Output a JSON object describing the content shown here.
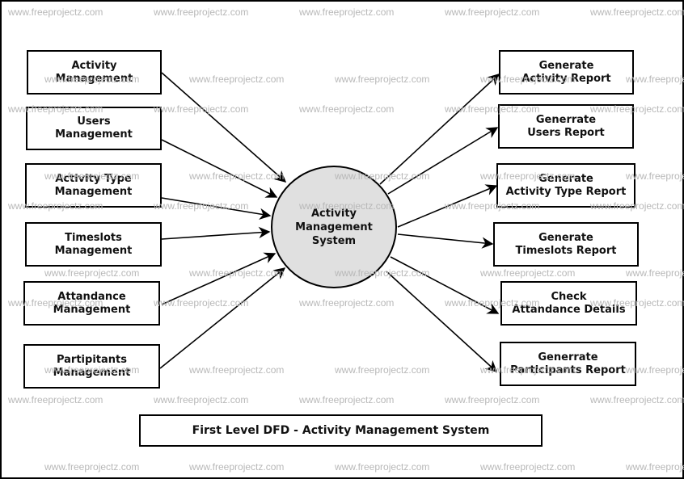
{
  "diagram": {
    "type": "data-flow-diagram",
    "title": "First Level DFD - Activity Management System",
    "process": {
      "id": "p0",
      "label": "Activity\nManagement\nSystem"
    },
    "inputs": [
      {
        "id": "in1",
        "label": "Activity\nManagement"
      },
      {
        "id": "in2",
        "label": "Users\nManagement"
      },
      {
        "id": "in3",
        "label": "Activity Type\nManagement"
      },
      {
        "id": "in4",
        "label": "Timeslots\nManagement"
      },
      {
        "id": "in5",
        "label": "Attandance\nManagement"
      },
      {
        "id": "in6",
        "label": "Partipitants\nManagement"
      }
    ],
    "outputs": [
      {
        "id": "out1",
        "label": "Generate\nActivity Report"
      },
      {
        "id": "out2",
        "label": "Generrate\nUsers Report"
      },
      {
        "id": "out3",
        "label": "Generate\nActivity Type Report"
      },
      {
        "id": "out4",
        "label": "Generate\nTimeslots Report"
      },
      {
        "id": "out5",
        "label": "Check\nAttandance Details"
      },
      {
        "id": "out6",
        "label": "Generrate\nParticipants Report"
      }
    ],
    "edges": [
      {
        "from": "in1",
        "to": "p0"
      },
      {
        "from": "in2",
        "to": "p0"
      },
      {
        "from": "in3",
        "to": "p0"
      },
      {
        "from": "in4",
        "to": "p0"
      },
      {
        "from": "in5",
        "to": "p0"
      },
      {
        "from": "in6",
        "to": "p0"
      },
      {
        "from": "p0",
        "to": "out1"
      },
      {
        "from": "p0",
        "to": "out2"
      },
      {
        "from": "p0",
        "to": "out3"
      },
      {
        "from": "p0",
        "to": "out4"
      },
      {
        "from": "p0",
        "to": "out5"
      },
      {
        "from": "p0",
        "to": "out6"
      }
    ]
  },
  "watermark": {
    "text": "www.freeprojectz.com"
  },
  "colors": {
    "process_fill": "#e0e0e0",
    "stroke": "#000000",
    "watermark": "#b8b8b8"
  }
}
